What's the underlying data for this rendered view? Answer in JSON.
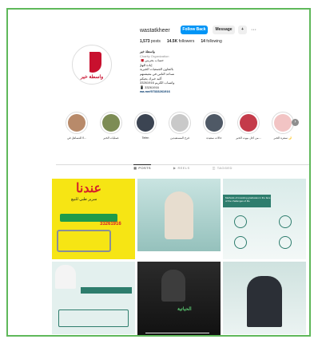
{
  "profile": {
    "username": "wastatkheer",
    "follow_back_label": "Follow Back",
    "message_label": "Message",
    "add_user_glyph": "+",
    "more_glyph": "···",
    "posts": "1,573",
    "posts_label": "posts",
    "followers": "14.5K",
    "followers_label": "followers",
    "following": "14",
    "following_label": "following",
    "brand_text": "واسطة خير"
  },
  "bio": {
    "name": "واسطة خير",
    "category": "Charity Organization",
    "lines": [
      "حساب بحريني 🇧🇭",
      "إبادة للهمّ",
      "بالتعاون الجمعيات الخيرية",
      "نساعد الناس في معيشتهم",
      "أكيد خيرك يجيكم",
      "واتساب الكريم 33261916",
      "📱 33261916"
    ],
    "link": "wa.me/97333261916"
  },
  "highlights": [
    {
      "label": "لا للتساهل في...",
      "color": "#b88a6a"
    },
    {
      "label": "عمليات الخير",
      "color": "#7d8c55"
    },
    {
      "label": "Tefen",
      "color": "#3b4452"
    },
    {
      "label": "فرح المستفيدين",
      "color": "#c9c9c9"
    },
    {
      "label": "حالات سعيدة",
      "color": "#4f5966"
    },
    {
      "label": "من أجل بيوت الخير...",
      "color": "#c43b4a"
    },
    {
      "label": "سفرة الخير 🌙",
      "color": "#f2c4c4"
    }
  ],
  "tabs": [
    {
      "label": "POSTS",
      "icon": "grid-icon",
      "active": true
    },
    {
      "label": "REELS",
      "icon": "reels-icon",
      "active": false
    },
    {
      "label": "TAGGED",
      "icon": "tagged-icon",
      "active": false
    }
  ],
  "posts_grid": [
    {
      "name": "post-bed-ad",
      "title": "عندنا",
      "subtitle": "سرير طبي للبيع",
      "phone": "33261916"
    },
    {
      "name": "post-woman-speaker",
      "title": "",
      "subtitle": ""
    },
    {
      "name": "post-methods-english",
      "title": "Methods of investing graduates in the face of the challenges of life",
      "subtitle": ""
    },
    {
      "name": "post-man-ghutra",
      "title": "",
      "subtitle": ""
    },
    {
      "name": "post-audio-dark",
      "title": "الحياتية",
      "subtitle": ""
    },
    {
      "name": "post-man-suit",
      "title": "",
      "subtitle": ""
    }
  ]
}
